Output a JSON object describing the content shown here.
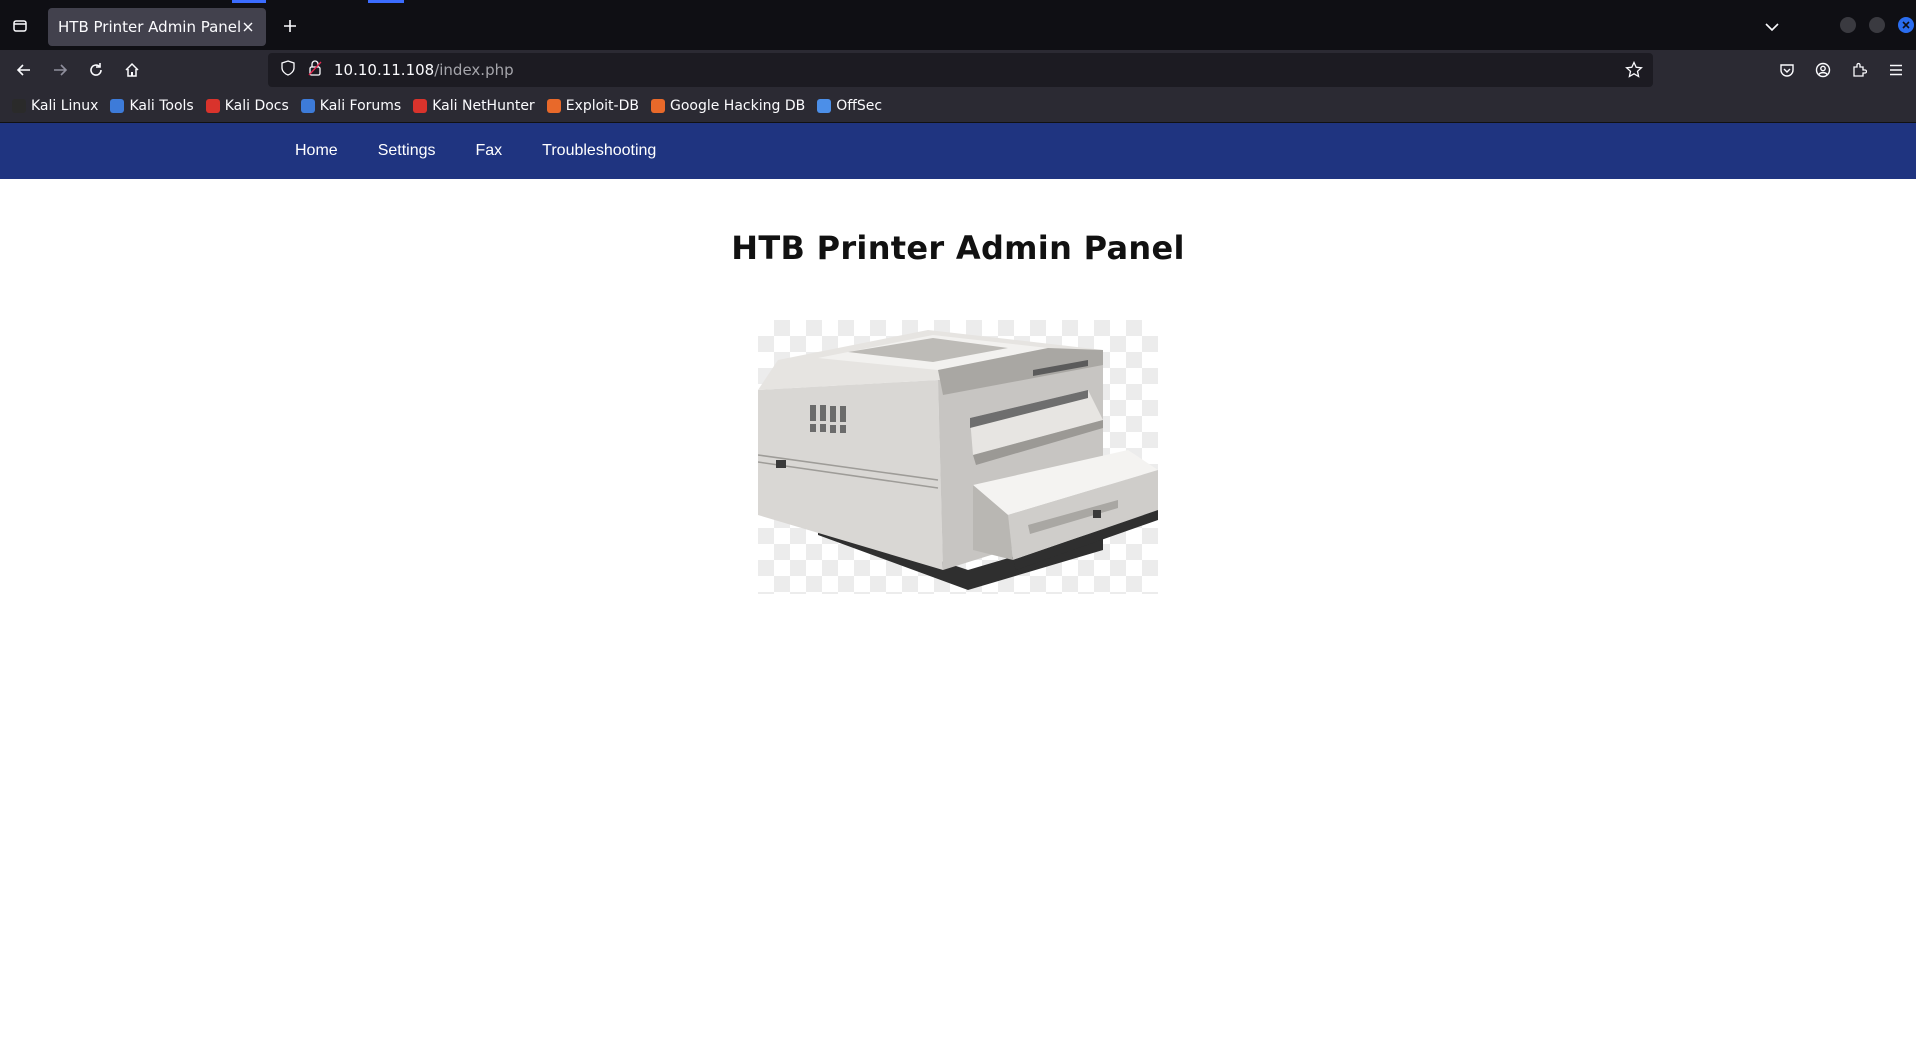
{
  "browser": {
    "tab_title": "HTB Printer Admin Panel",
    "url_host": "10.10.11.108",
    "url_path": "/index.php",
    "bookmarks": [
      {
        "label": "Kali Linux",
        "color": "#2a2a2a"
      },
      {
        "label": "Kali Tools",
        "color": "#3d7bd9"
      },
      {
        "label": "Kali Docs",
        "color": "#d9332c"
      },
      {
        "label": "Kali Forums",
        "color": "#3d7bd9"
      },
      {
        "label": "Kali NetHunter",
        "color": "#d9332c"
      },
      {
        "label": "Exploit-DB",
        "color": "#e8692a"
      },
      {
        "label": "Google Hacking DB",
        "color": "#e8692a"
      },
      {
        "label": "OffSec",
        "color": "#4c8fe8"
      }
    ]
  },
  "site": {
    "nav": [
      "Home",
      "Settings",
      "Fax",
      "Troubleshooting"
    ],
    "title": "HTB Printer Admin Panel",
    "image_icon": "printer-illustration"
  },
  "colors": {
    "site_nav_bg": "#1f3480",
    "page_bg": "#ffffff"
  }
}
